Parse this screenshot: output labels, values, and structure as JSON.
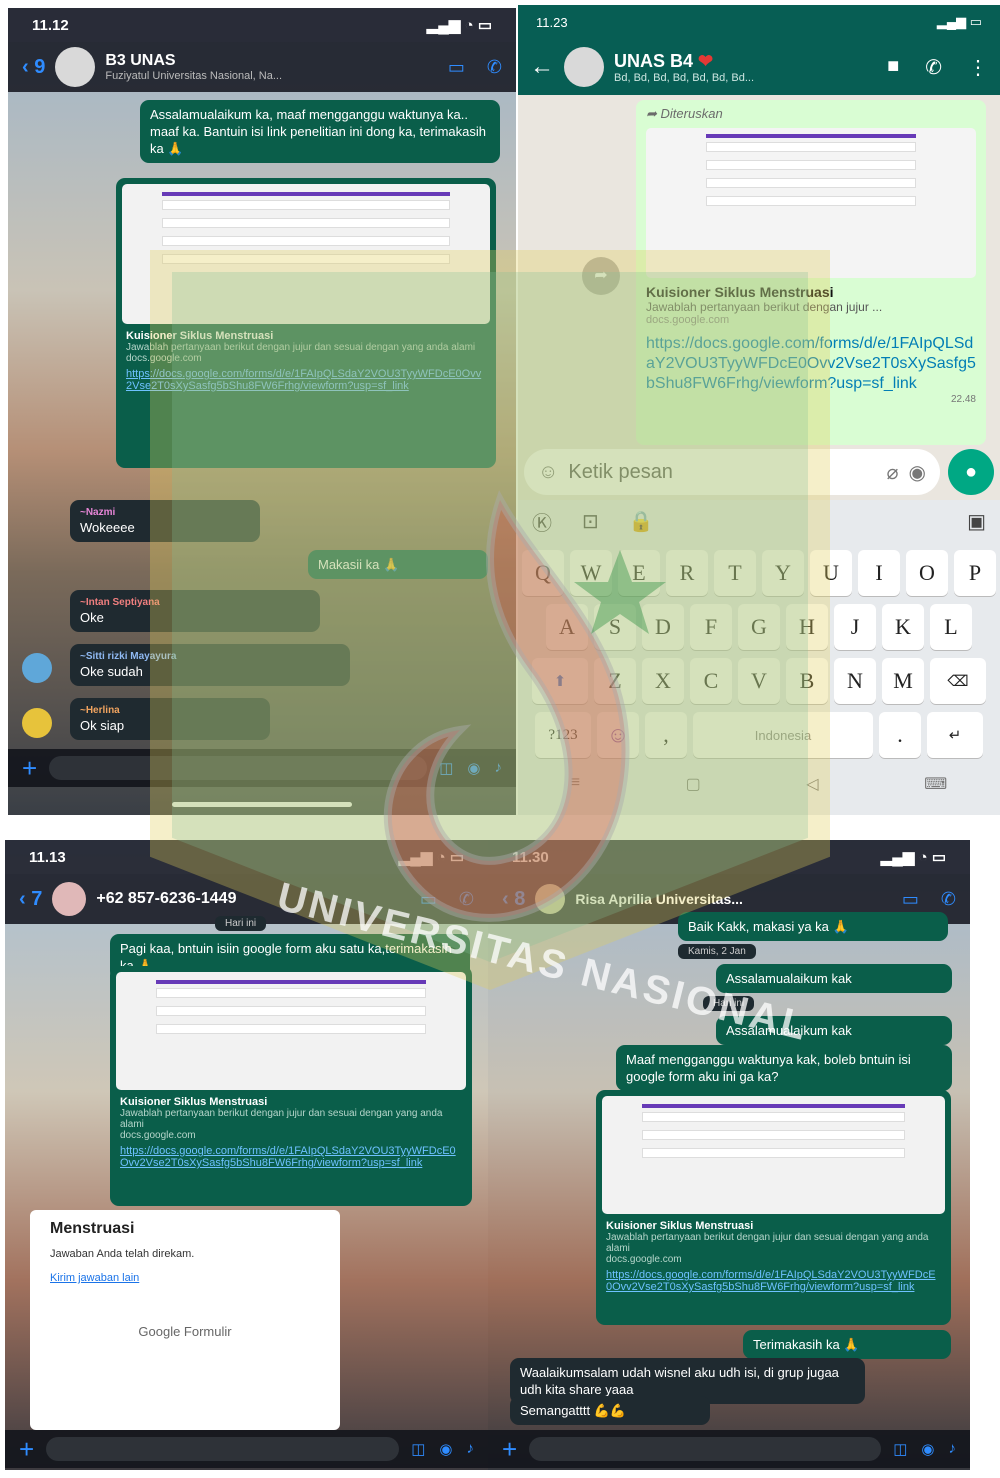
{
  "panel1": {
    "status_time": "11.12",
    "back_count": "9",
    "title": "B3 UNAS",
    "subtitle": "Fuziyatul Universitas Nasional, Na...",
    "message_out": "Assalamualaikum ka, maaf mengganggu waktunya ka.. maaf ka. Bantuin isi link penelitian ini dong ka, terimakasih ka",
    "card": {
      "title": "Kuisioner Siklus Menstruasi",
      "desc": "Jawablah pertanyaan berikut dengan jujur dan sesuai dengan yang anda alami",
      "domain": "docs.google.com",
      "link": "https://docs.google.com/forms/d/e/1FAIpQLSdaY2VOU3TyyWFDcE0Ovv2Vse2T0sXySasfg5bShu8FW6Frhg/viewform?usp=sf_link"
    },
    "thanks": "Makasii ka",
    "replies": [
      {
        "sender": "~Nazmi",
        "text": "Wokeeee"
      },
      {
        "sender": "~Intan Septiyana",
        "text": "Oke"
      },
      {
        "sender": "~Sitti rizki Mayayura",
        "text": "Oke sudah"
      },
      {
        "sender": "~Herlina",
        "text": "Ok siap"
      }
    ]
  },
  "panel2": {
    "status_time": "11.23",
    "title": "UNAS B4",
    "subtitle": "Bd, Bd, Bd, Bd, Bd, Bd, Bd...",
    "forwarded": "Diteruskan",
    "card_title": "Kuisioner Siklus Menstruasi",
    "card_desc": "Jawablah pertanyaan berikut dengan jujur ...",
    "card_domain": "docs.google.com",
    "link": "https://docs.google.com/forms/d/e/1FAIpQLSdaY2VOU3TyyWFDcE0Ovv2Vse2T0sXySasfg5bShu8FW6Frhg/viewform?usp=sf_link",
    "time": "22.48",
    "input_placeholder": "Ketik pesan",
    "keyboard": {
      "row1": [
        "Q",
        "W",
        "E",
        "R",
        "T",
        "Y",
        "U",
        "I",
        "O",
        "P"
      ],
      "row2": [
        "A",
        "S",
        "D",
        "F",
        "G",
        "H",
        "J",
        "K",
        "L"
      ],
      "row3": [
        "Z",
        "X",
        "C",
        "V",
        "B",
        "N",
        "M"
      ],
      "symbols": "?123",
      "space": "Indonesia"
    }
  },
  "panel3": {
    "status_time": "11.13",
    "back_count": "7",
    "title": "+62 857-6236-1449",
    "date": "Hari ini",
    "message_out": "Pagi kaa, bntuin isiin google form aku satu ka,terimakasih ka",
    "card_title": "Kuisioner Siklus Menstruasi",
    "card_desc": "Jawablah pertanyaan berikut dengan jujur dan sesuai dengan yang anda alami",
    "card_domain": "docs.google.com",
    "link": "https://docs.google.com/forms/d/e/1FAIpQLSdaY2VOU3TyyWFDcE0Ovv2Vse2T0sXySasfg5bShu8FW6Frhg/viewform?usp=sf_link",
    "form_title": "Menstruasi",
    "form_submitted": "Jawaban Anda telah direkam.",
    "form_edit": "Kirim jawaban lain",
    "form_brand": "Google Formulir"
  },
  "panel4": {
    "status_time": "11.30",
    "back_count": "8",
    "title": "Risa Aprilia Universitas...",
    "msg1": "Baik Kakk, makasi ya ka",
    "date1": "Kamis, 2 Jan",
    "msg2": "Assalamualaikum kak",
    "date2": "Hari ini",
    "msg3": "Assalamualaikum kak",
    "msg4": "Maaf mengganggu waktunya kak, boleb bntuin isi google form aku ini ga ka?",
    "card_title": "Kuisioner Siklus Menstruasi",
    "card_desc": "Jawablah pertanyaan berikut dengan jujur dan sesuai dengan yang anda alami",
    "card_domain": "docs.google.com",
    "link": "https://docs.google.com/forms/d/e/1FAIpQLSdaY2VOU3TyyWFDcE0Ovv2Vse2T0sXySasfg5bShu8FW6Frhg/viewform?usp=sf_link",
    "thanks": "Terimakasih ka",
    "reply": "Waalaikumsalam udah wisnel aku udh isi, di grup jugaa udh kita share yaaa",
    "reply2": "Semangatttt"
  },
  "watermark": "UNIVERSITAS NASIONAL"
}
